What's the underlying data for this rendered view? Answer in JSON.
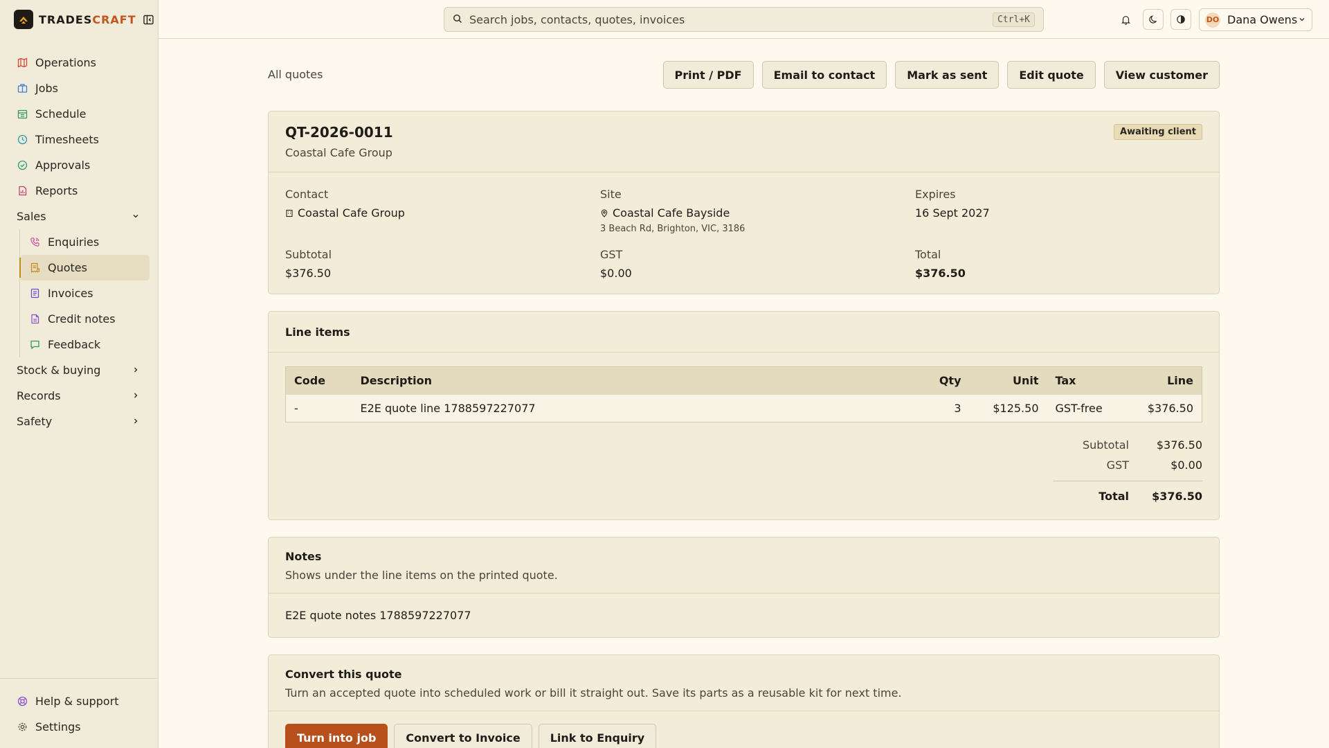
{
  "brand": {
    "name_main": "TRADES",
    "name_accent": "CRAFT"
  },
  "sidebar": {
    "items": [
      {
        "label": "Operations",
        "icon": "map-icon",
        "color": "#d9473a"
      },
      {
        "label": "Jobs",
        "icon": "briefcase-icon",
        "color": "#3b7dd8"
      },
      {
        "label": "Schedule",
        "icon": "calendar-icon",
        "color": "#2e9b5a"
      },
      {
        "label": "Timesheets",
        "icon": "clock-icon",
        "color": "#2a9ab0"
      },
      {
        "label": "Approvals",
        "icon": "check-circle-icon",
        "color": "#2e9b7a"
      },
      {
        "label": "Reports",
        "icon": "file-chart-icon",
        "color": "#c0407a"
      }
    ],
    "sales_label": "Sales",
    "sales_items": [
      {
        "label": "Enquiries",
        "icon": "phone-icon",
        "color": "#d0509a"
      },
      {
        "label": "Quotes",
        "icon": "receipt-icon",
        "color": "#c58a1e"
      },
      {
        "label": "Invoices",
        "icon": "invoice-icon",
        "color": "#6a4fd8"
      },
      {
        "label": "Credit notes",
        "icon": "file-icon",
        "color": "#8a4fd0"
      },
      {
        "label": "Feedback",
        "icon": "message-icon",
        "color": "#2e9b5a"
      }
    ],
    "groups": [
      "Stock & buying",
      "Records",
      "Safety"
    ],
    "bottom": [
      {
        "label": "Help & support",
        "icon": "lifebuoy-icon",
        "color": "#8a4fd0"
      },
      {
        "label": "Settings",
        "icon": "gear-icon",
        "color": "#4a443a"
      }
    ]
  },
  "topbar": {
    "search_placeholder": "Search jobs, contacts, quotes, invoices",
    "search_shortcut": "Ctrl+K",
    "user_initials": "DO",
    "user_name": "Dana Owens"
  },
  "page": {
    "breadcrumb": "All quotes",
    "actions": [
      "Print / PDF",
      "Email to contact",
      "Mark as sent",
      "Edit quote",
      "View customer"
    ]
  },
  "quote": {
    "number": "QT-2026-0011",
    "client": "Coastal Cafe Group",
    "status": "Awaiting client",
    "contact_label": "Contact",
    "contact": "Coastal Cafe Group",
    "site_label": "Site",
    "site_name": "Coastal Cafe Bayside",
    "site_address": "3 Beach Rd, Brighton, VIC, 3186",
    "expires_label": "Expires",
    "expires": "16 Sept 2027",
    "subtotal_label": "Subtotal",
    "subtotal": "$376.50",
    "gst_label": "GST",
    "gst": "$0.00",
    "total_label": "Total",
    "total": "$376.50"
  },
  "line_items": {
    "title": "Line items",
    "headers": {
      "code": "Code",
      "description": "Description",
      "qty": "Qty",
      "unit": "Unit",
      "tax": "Tax",
      "line": "Line"
    },
    "rows": [
      {
        "code": "-",
        "description": "E2E quote line 1788597227077",
        "qty": "3",
        "unit": "$125.50",
        "tax": "GST-free",
        "line": "$376.50"
      }
    ],
    "totals": {
      "subtotal_label": "Subtotal",
      "subtotal": "$376.50",
      "gst_label": "GST",
      "gst": "$0.00",
      "total_label": "Total",
      "total": "$376.50"
    }
  },
  "notes": {
    "title": "Notes",
    "hint": "Shows under the line items on the printed quote.",
    "text": "E2E quote notes 1788597227077"
  },
  "convert": {
    "title": "Convert this quote",
    "description": "Turn an accepted quote into scheduled work or bill it straight out. Save its parts as a reusable kit for next time.",
    "buttons": [
      "Turn into job",
      "Convert to Invoice",
      "Link to Enquiry"
    ]
  }
}
